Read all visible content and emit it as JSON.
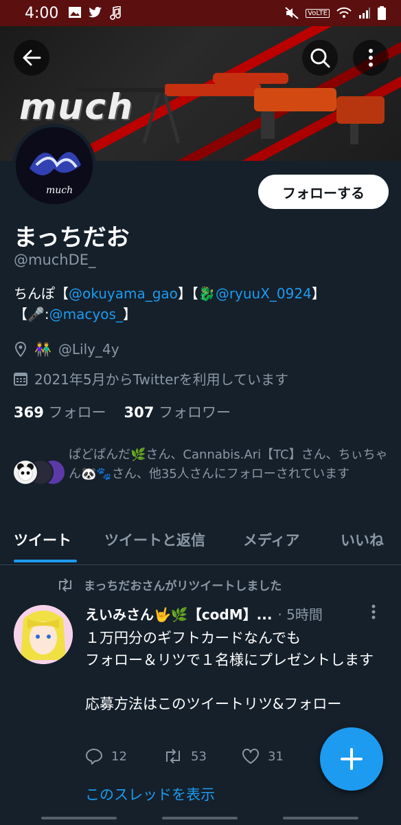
{
  "status_bar": {
    "time": "4:00",
    "volte": "VoLTE"
  },
  "banner": {
    "word": "much"
  },
  "profile": {
    "name": "まっちだお",
    "handle": "@muchDE_",
    "follow_label": "フォローする",
    "bio_prefix": "ちんぽ【",
    "bio_link1": "@okuyama_gao",
    "bio_mid1": "】【",
    "bio_emoji1": "🐉",
    "bio_link2": "@ryuuX_0924",
    "bio_mid2": "】",
    "bio_line2_prefix": "【",
    "bio_emoji2": "🎤",
    "bio_colon": ":",
    "bio_link3": "@macyos_",
    "bio_line2_suffix": "】",
    "location_emoji": "👫",
    "location": "@Lily_4y",
    "joined": "2021年5月からTwitterを利用しています",
    "following_count": "369",
    "following_label": "フォロー",
    "followers_count": "307",
    "followers_label": "フォロワー",
    "followed_by": "ぱどぱんだ🌿さん、Cannabis.Ari【TC】さん、ちぃちゃん🐼🐾さん、他35人さんにフォローされています"
  },
  "tabs": [
    {
      "label": "ツイート",
      "active": true
    },
    {
      "label": "ツイートと返信",
      "active": false
    },
    {
      "label": "メディア",
      "active": false
    },
    {
      "label": "いいね",
      "active": false
    }
  ],
  "tweet": {
    "retweet_note": "まっちだおさんがリツイートしました",
    "author": "えいみさん🤟🌿【codM】...",
    "time": "· 5時間",
    "text": "１万円分のギフトカードなんでも\nフォロー＆リツで１名様にプレゼントします\n\n応募方法はこのツイートリツ&フォロー",
    "replies": "12",
    "retweets": "53",
    "likes": "31",
    "thread_link": "このスレッドを表示"
  },
  "colors": {
    "background": "#15202b",
    "accent": "#1d9bf0",
    "status_bar": "#5b0f0f"
  },
  "icons": [
    "back-arrow-icon",
    "search-icon",
    "more-vertical-icon",
    "location-icon",
    "calendar-icon",
    "retweet-icon",
    "reply-icon",
    "like-icon",
    "plus-icon"
  ]
}
